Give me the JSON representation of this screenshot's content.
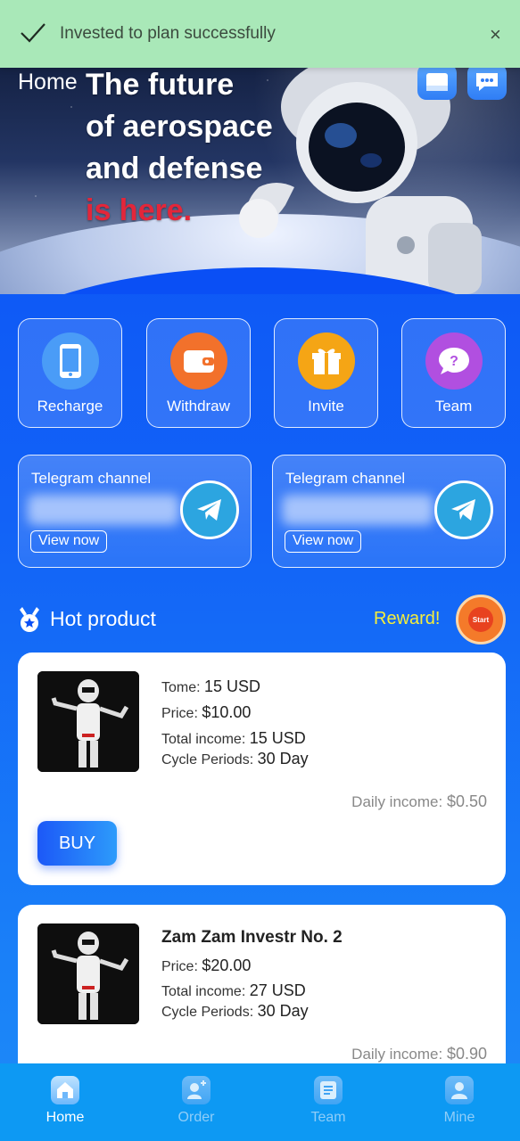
{
  "toast": {
    "message": "Invested to plan successfully",
    "close_label": "×",
    "icon": "check-icon"
  },
  "header": {
    "title": "Home",
    "banner_lines": [
      "The future",
      "of aerospace",
      "and defense"
    ],
    "banner_highlight": "is here.",
    "icons": [
      "mail-icon",
      "chat-icon"
    ]
  },
  "actions": [
    {
      "label": "Recharge",
      "icon": "phone-icon",
      "color": "#4a9cf7"
    },
    {
      "label": "Withdraw",
      "icon": "wallet-icon",
      "color": "#f2712b"
    },
    {
      "label": "Invite",
      "icon": "gift-icon",
      "color": "#f5a515"
    },
    {
      "label": "Team",
      "icon": "question-chat-icon",
      "color": "#b14fe0"
    }
  ],
  "telegram": [
    {
      "title": "Telegram channel",
      "button": "View now",
      "icon": "telegram-icon"
    },
    {
      "title": "Telegram channel",
      "button": "View now",
      "icon": "telegram-icon"
    }
  ],
  "hot_product": {
    "title": "Hot product",
    "reward_label": "Reward!",
    "reward_badge": "Start"
  },
  "products": [
    {
      "name_label": "Tome:",
      "name_value": "15 USD",
      "price_label": "Price:",
      "price_value": "$10.00",
      "total_label": "Total income:",
      "total_value": "15 USD",
      "cycle_label": "Cycle Periods:",
      "cycle_value": "30 Day",
      "daily_label": "Daily income:",
      "daily_value": "$0.50",
      "buy_label": "BUY"
    },
    {
      "name": "Zam Zam Investr No. 2",
      "price_label": "Price:",
      "price_value": "$20.00",
      "total_label": "Total income:",
      "total_value": "27 USD",
      "cycle_label": "Cycle Periods:",
      "cycle_value": "30 Day",
      "daily_label": "Daily income:",
      "daily_value": "$0.90"
    }
  ],
  "nav": [
    {
      "label": "Home",
      "icon": "home-icon",
      "active": true
    },
    {
      "label": "Order",
      "icon": "order-icon",
      "active": false
    },
    {
      "label": "Team",
      "icon": "team-icon",
      "active": false
    },
    {
      "label": "Mine",
      "icon": "user-icon",
      "active": false
    }
  ],
  "colors": {
    "primary": "#0a4ff5",
    "toast_bg": "#a9e8b8",
    "reward_text": "#f5ee3b",
    "nav_bg": "#0d99f3",
    "highlight_red": "#e3263a"
  }
}
